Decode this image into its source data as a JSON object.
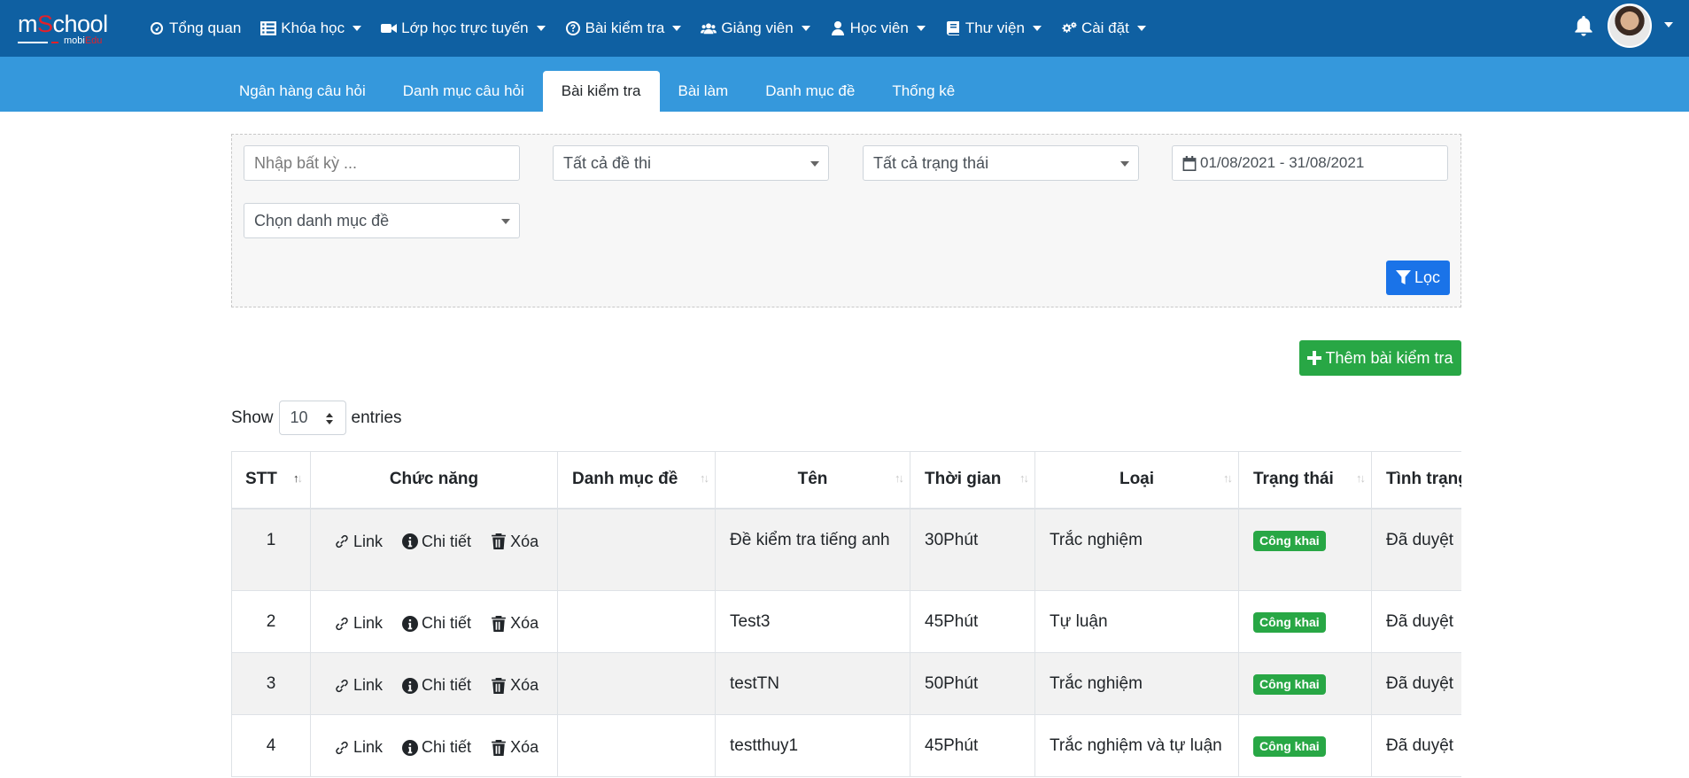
{
  "brand": {
    "name_prefix": "m",
    "name_mark": "S",
    "name_suffix": "chool",
    "sub_prefix": "mobi",
    "sub_suffix": "Edu"
  },
  "nav": [
    {
      "label": "Tổng quan",
      "icon": "dashboard-icon",
      "caret": false
    },
    {
      "label": "Khóa học",
      "icon": "list-icon",
      "caret": true
    },
    {
      "label": "Lớp học trực tuyến",
      "icon": "video-icon",
      "caret": true
    },
    {
      "label": "Bài kiểm tra",
      "icon": "question-circle-icon",
      "caret": true
    },
    {
      "label": "Giảng viên",
      "icon": "users-icon",
      "caret": true
    },
    {
      "label": "Học viên",
      "icon": "user-icon",
      "caret": true
    },
    {
      "label": "Thư viện",
      "icon": "book-icon",
      "caret": true
    },
    {
      "label": "Cài đặt",
      "icon": "gears-icon",
      "caret": true
    }
  ],
  "tabs": [
    {
      "label": "Ngân hàng câu hỏi",
      "active": false
    },
    {
      "label": "Danh mục câu hỏi",
      "active": false
    },
    {
      "label": "Bài kiểm tra",
      "active": true
    },
    {
      "label": "Bài làm",
      "active": false
    },
    {
      "label": "Danh mục đề",
      "active": false
    },
    {
      "label": "Thống kê",
      "active": false
    }
  ],
  "filter": {
    "search_placeholder": "Nhập bất kỳ ...",
    "exam_select": "Tất cả đề thi",
    "status_select": "Tất cả trạng thái",
    "date_range": "01/08/2021 - 31/08/2021",
    "category_select": "Chọn danh mục đề",
    "filter_button": "Lọc"
  },
  "add_button": "Thêm bài kiểm tra",
  "length": {
    "show": "Show",
    "value": "10",
    "entries": "entries"
  },
  "table": {
    "headers": [
      "STT",
      "Chức năng",
      "Danh mục đề",
      "Tên",
      "Thời gian",
      "Loại",
      "Trạng thái",
      "Tình trạng"
    ],
    "action_labels": {
      "link": "Link",
      "detail": "Chi tiết",
      "delete": "Xóa"
    },
    "rows": [
      {
        "stt": "1",
        "category": "",
        "name": "Đề kiểm tra tiếng anh",
        "time": "30Phút",
        "type": "Trắc nghiệm",
        "status": "Công khai",
        "state": "Đã duyệt"
      },
      {
        "stt": "2",
        "category": "",
        "name": "Test3",
        "time": "45Phút",
        "type": "Tự luận",
        "status": "Công khai",
        "state": "Đã duyệt"
      },
      {
        "stt": "3",
        "category": "",
        "name": "testTN",
        "time": "50Phút",
        "type": "Trắc nghiệm",
        "status": "Công khai",
        "state": "Đã duyệt"
      },
      {
        "stt": "4",
        "category": "",
        "name": "testthuy1",
        "time": "45Phút",
        "type": "Trắc nghiệm và tự luận",
        "status": "Công khai",
        "state": "Đã duyệt"
      }
    ]
  },
  "colors": {
    "topbar": "#0f60a2",
    "subbar": "#3598dc",
    "filter_button": "#1a73e8",
    "add_button": "#28a745",
    "badge": "#28a745"
  }
}
